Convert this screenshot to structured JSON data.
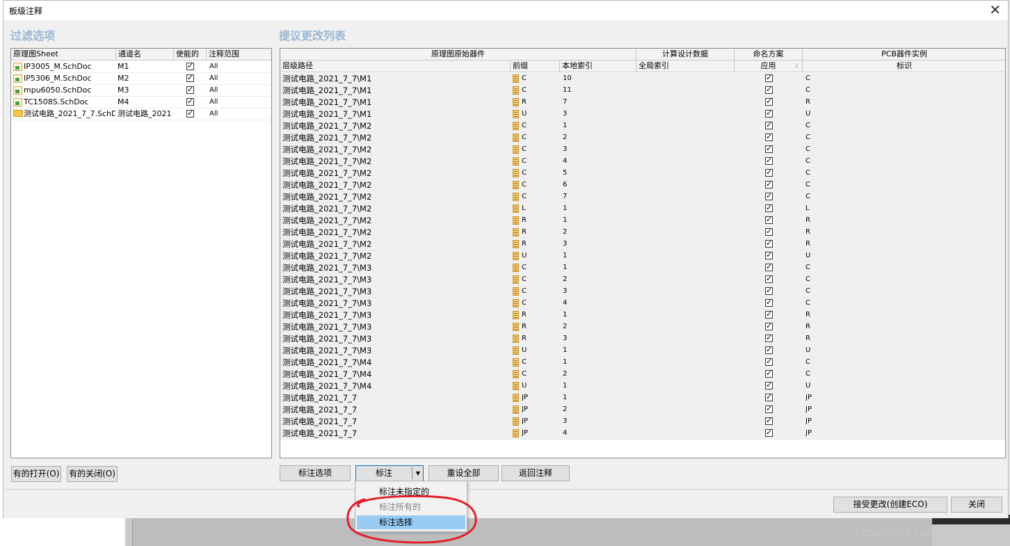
{
  "window": {
    "title": "板级注释"
  },
  "filter": {
    "section_title": "过滤选项",
    "headers": {
      "sheet": "原理图Sheet",
      "channel": "通道名",
      "enabled": "使能的",
      "scope": "注释范围"
    },
    "rows": [
      {
        "sheet": "IP3005_M.SchDoc",
        "channel": "M1",
        "enabled": true,
        "scope": "All",
        "icon": "schematic-sheet-icon"
      },
      {
        "sheet": "IP5306_M.SchDoc",
        "channel": "M2",
        "enabled": true,
        "scope": "All",
        "icon": "schematic-sheet-icon"
      },
      {
        "sheet": "mpu6050.SchDoc",
        "channel": "M3",
        "enabled": true,
        "scope": "All",
        "icon": "schematic-sheet-icon"
      },
      {
        "sheet": "TC1508S.SchDoc",
        "channel": "M4",
        "enabled": true,
        "scope": "All",
        "icon": "schematic-sheet-icon"
      },
      {
        "sheet": "测试电路_2021_7_7.SchD",
        "channel": "测试电路_2021",
        "enabled": true,
        "scope": "All",
        "icon": "folder-icon"
      }
    ],
    "btn_open_all": "有的打开(O)",
    "btn_close_all": "有的关闭(O)"
  },
  "changes": {
    "section_title": "提议更改列表",
    "group_headers": {
      "original": "原理图原始器件",
      "computed": "计算设计数据",
      "naming": "命名方案",
      "pcb": "PCB器件实例"
    },
    "headers": {
      "path": "层级路径",
      "prefix": "前缀",
      "local_index": "本地索引",
      "global_index": "全局索引",
      "apply": "应用",
      "designator": "标识"
    },
    "rows": [
      {
        "path": "测试电路_2021_7_7\\M1",
        "prefix": "C",
        "local": "10",
        "apply": true,
        "designator": "C"
      },
      {
        "path": "测试电路_2021_7_7\\M1",
        "prefix": "C",
        "local": "11",
        "apply": true,
        "designator": "C"
      },
      {
        "path": "测试电路_2021_7_7\\M1",
        "prefix": "R",
        "local": "7",
        "apply": true,
        "designator": "R"
      },
      {
        "path": "测试电路_2021_7_7\\M1",
        "prefix": "U",
        "local": "3",
        "apply": true,
        "designator": "U"
      },
      {
        "path": "测试电路_2021_7_7\\M2",
        "prefix": "C",
        "local": "1",
        "apply": true,
        "designator": "C"
      },
      {
        "path": "测试电路_2021_7_7\\M2",
        "prefix": "C",
        "local": "2",
        "apply": true,
        "designator": "C"
      },
      {
        "path": "测试电路_2021_7_7\\M2",
        "prefix": "C",
        "local": "3",
        "apply": true,
        "designator": "C"
      },
      {
        "path": "测试电路_2021_7_7\\M2",
        "prefix": "C",
        "local": "4",
        "apply": true,
        "designator": "C"
      },
      {
        "path": "测试电路_2021_7_7\\M2",
        "prefix": "C",
        "local": "5",
        "apply": true,
        "designator": "C"
      },
      {
        "path": "测试电路_2021_7_7\\M2",
        "prefix": "C",
        "local": "6",
        "apply": true,
        "designator": "C"
      },
      {
        "path": "测试电路_2021_7_7\\M2",
        "prefix": "C",
        "local": "7",
        "apply": true,
        "designator": "C"
      },
      {
        "path": "测试电路_2021_7_7\\M2",
        "prefix": "L",
        "local": "1",
        "apply": true,
        "designator": "L"
      },
      {
        "path": "测试电路_2021_7_7\\M2",
        "prefix": "R",
        "local": "1",
        "apply": true,
        "designator": "R"
      },
      {
        "path": "测试电路_2021_7_7\\M2",
        "prefix": "R",
        "local": "2",
        "apply": true,
        "designator": "R"
      },
      {
        "path": "测试电路_2021_7_7\\M2",
        "prefix": "R",
        "local": "3",
        "apply": true,
        "designator": "R"
      },
      {
        "path": "测试电路_2021_7_7\\M2",
        "prefix": "U",
        "local": "1",
        "apply": true,
        "designator": "U"
      },
      {
        "path": "测试电路_2021_7_7\\M3",
        "prefix": "C",
        "local": "1",
        "apply": true,
        "designator": "C"
      },
      {
        "path": "测试电路_2021_7_7\\M3",
        "prefix": "C",
        "local": "2",
        "apply": true,
        "designator": "C"
      },
      {
        "path": "测试电路_2021_7_7\\M3",
        "prefix": "C",
        "local": "3",
        "apply": true,
        "designator": "C"
      },
      {
        "path": "测试电路_2021_7_7\\M3",
        "prefix": "C",
        "local": "4",
        "apply": true,
        "designator": "C"
      },
      {
        "path": "测试电路_2021_7_7\\M3",
        "prefix": "R",
        "local": "1",
        "apply": true,
        "designator": "R"
      },
      {
        "path": "测试电路_2021_7_7\\M3",
        "prefix": "R",
        "local": "2",
        "apply": true,
        "designator": "R"
      },
      {
        "path": "测试电路_2021_7_7\\M3",
        "prefix": "R",
        "local": "3",
        "apply": true,
        "designator": "R"
      },
      {
        "path": "测试电路_2021_7_7\\M3",
        "prefix": "U",
        "local": "1",
        "apply": true,
        "designator": "U"
      },
      {
        "path": "测试电路_2021_7_7\\M4",
        "prefix": "C",
        "local": "1",
        "apply": true,
        "designator": "C"
      },
      {
        "path": "测试电路_2021_7_7\\M4",
        "prefix": "C",
        "local": "2",
        "apply": true,
        "designator": "C"
      },
      {
        "path": "测试电路_2021_7_7\\M4",
        "prefix": "U",
        "local": "1",
        "apply": true,
        "designator": "U"
      },
      {
        "path": "测试电路_2021_7_7",
        "prefix": "JP",
        "local": "1",
        "apply": true,
        "designator": "JP"
      },
      {
        "path": "测试电路_2021_7_7",
        "prefix": "JP",
        "local": "2",
        "apply": true,
        "designator": "JP"
      },
      {
        "path": "测试电路_2021_7_7",
        "prefix": "JP",
        "local": "3",
        "apply": true,
        "designator": "JP"
      },
      {
        "path": "测试电路_2021_7_7",
        "prefix": "JP",
        "local": "4",
        "apply": true,
        "designator": "JP"
      }
    ]
  },
  "buttons": {
    "annotate_options": "标注选项",
    "annotate": "标注",
    "reset_all": "重设全部",
    "back_annotate": "返回注释",
    "accept_changes": "接受更改(创建ECO)",
    "close": "关闭"
  },
  "dropdown": {
    "items": [
      {
        "label": "标注未指定的",
        "state": "normal"
      },
      {
        "label": "标注所有的",
        "state": "disabled"
      },
      {
        "label": "标注选择",
        "state": "highlighted"
      }
    ]
  },
  "watermark": "https://blog.csdn.net/Madon_G",
  "colors": {
    "section_title": "#9bb7d4",
    "menu_highlight": "#99ccf4",
    "annotation_circle": "#e0202a"
  }
}
